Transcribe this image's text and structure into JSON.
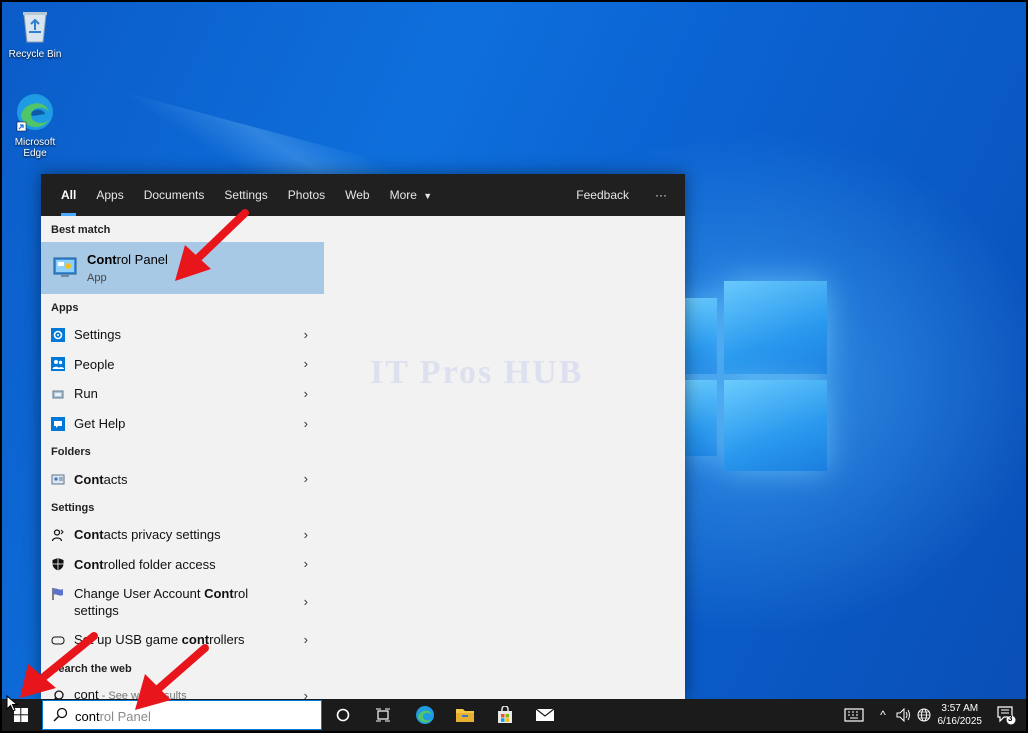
{
  "desktop": {
    "icons": [
      {
        "label": "Recycle Bin"
      },
      {
        "label": "Microsoft Edge"
      }
    ]
  },
  "search": {
    "tabs": [
      "All",
      "Apps",
      "Documents",
      "Settings",
      "Photos",
      "Web",
      "More"
    ],
    "feedback": "Feedback",
    "more_options": "···",
    "sections": {
      "best_match": "Best match",
      "apps": "Apps",
      "folders": "Folders",
      "settings": "Settings",
      "web": "Search the web"
    },
    "best_match": {
      "title_bold": "Cont",
      "title_rest": "rol Panel",
      "subtitle": "App"
    },
    "apps": [
      "Settings",
      "People",
      "Run",
      "Get Help"
    ],
    "folders": [
      {
        "bold": "Cont",
        "rest": "acts"
      }
    ],
    "settings": [
      {
        "pre": "",
        "bold": "Cont",
        "rest": "acts privacy settings"
      },
      {
        "pre": "",
        "bold": "Cont",
        "rest": "rolled folder access"
      },
      {
        "pre": "Change User Account ",
        "bold": "Cont",
        "rest": "rol settings"
      },
      {
        "pre": "Set up USB game ",
        "bold": "cont",
        "rest": "rollers"
      }
    ],
    "web": {
      "query": "cont",
      "hint": " - See web results"
    },
    "watermark": "IT Pros HUB"
  },
  "taskbar": {
    "typed": "cont",
    "autocomplete": "rol Panel",
    "clock_time": "3:57 AM",
    "clock_date": "6/16/2025",
    "notification_count": "3"
  }
}
